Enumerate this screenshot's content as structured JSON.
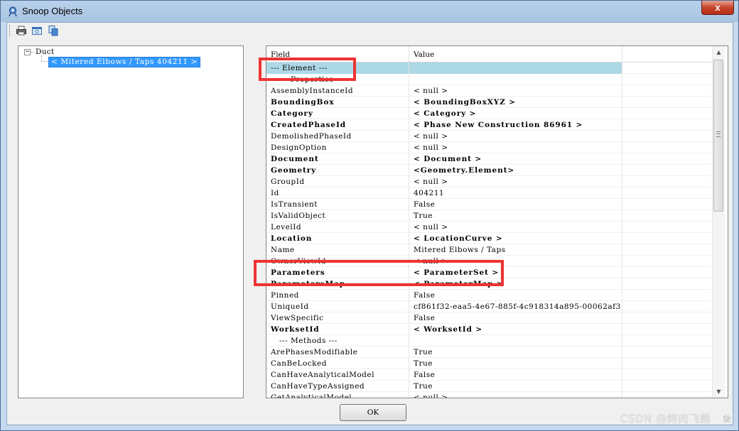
{
  "window": {
    "title": "Snoop Objects",
    "close_label": "x"
  },
  "toolbar": {
    "buttons": [
      "print-icon",
      "print-preview-icon",
      "copy-icon"
    ]
  },
  "tree": {
    "expander": "−",
    "root": "Duct",
    "child": "< Mitered Elbows / Taps  404211 >"
  },
  "grid": {
    "columns": [
      "Field",
      "Value"
    ],
    "rows": [
      {
        "field": "--- Element ---",
        "value": "",
        "style": "selected"
      },
      {
        "field": "--- Properties ---",
        "value": "",
        "style": "section-partial"
      },
      {
        "field": "AssemblyInstanceId",
        "value": "< null >",
        "style": "normal"
      },
      {
        "field": "BoundingBox",
        "value": "< BoundingBoxXYZ >",
        "style": "bold"
      },
      {
        "field": "Category",
        "value": "< Category >",
        "style": "bold"
      },
      {
        "field": "CreatedPhaseId",
        "value": "< Phase  New Construction  86961 >",
        "style": "bold"
      },
      {
        "field": "DemolishedPhaseId",
        "value": "< null >",
        "style": "normal"
      },
      {
        "field": "DesignOption",
        "value": "< null >",
        "style": "normal"
      },
      {
        "field": "Document",
        "value": "< Document >",
        "style": "bold"
      },
      {
        "field": "Geometry",
        "value": "<Geometry.Element>",
        "style": "bold"
      },
      {
        "field": "GroupId",
        "value": "< null >",
        "style": "normal"
      },
      {
        "field": "Id",
        "value": "404211",
        "style": "normal"
      },
      {
        "field": "IsTransient",
        "value": "False",
        "style": "normal"
      },
      {
        "field": "IsValidObject",
        "value": "True",
        "style": "normal"
      },
      {
        "field": "LevelId",
        "value": "< null >",
        "style": "normal"
      },
      {
        "field": "Location",
        "value": "< LocationCurve >",
        "style": "bold"
      },
      {
        "field": "Name",
        "value": "Mitered Elbows / Taps",
        "style": "normal"
      },
      {
        "field": "OwnerViewId",
        "value": "< null >",
        "style": "partial"
      },
      {
        "field": "Parameters",
        "value": "< ParameterSet >",
        "style": "bold"
      },
      {
        "field": "ParametersMap",
        "value": "< ParameterMap >",
        "style": "bold-partial"
      },
      {
        "field": "Pinned",
        "value": "False",
        "style": "normal"
      },
      {
        "field": "UniqueId",
        "value": "cf861f32-eaa5-4e67-885f-4c918314a895-00062af3",
        "style": "normal"
      },
      {
        "field": "ViewSpecific",
        "value": "False",
        "style": "normal"
      },
      {
        "field": "WorksetId",
        "value": "< WorksetId >",
        "style": "bold"
      },
      {
        "field": "--- Methods ---",
        "value": "",
        "style": "section"
      },
      {
        "field": "ArePhasesModifiable",
        "value": "True",
        "style": "normal"
      },
      {
        "field": "CanBeLocked",
        "value": "True",
        "style": "normal"
      },
      {
        "field": "CanHaveAnalyticalModel",
        "value": "False",
        "style": "normal"
      },
      {
        "field": "CanHaveTypeAssigned",
        "value": "True",
        "style": "normal"
      },
      {
        "field": "GetAnalyticalModel",
        "value": "< null >",
        "style": "partial-bottom"
      }
    ]
  },
  "buttons": {
    "ok": "OK"
  },
  "watermark": "CSDN @烤肉飞熊"
}
